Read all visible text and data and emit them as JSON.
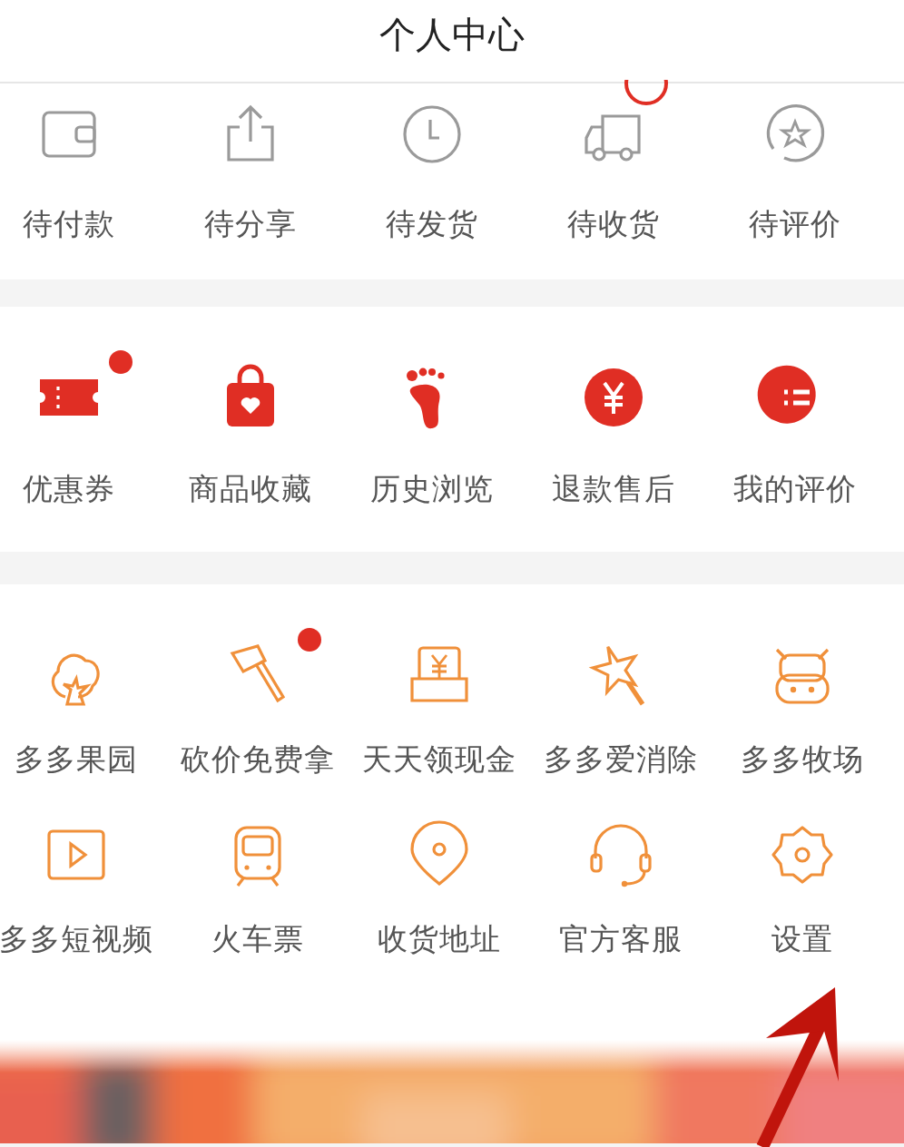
{
  "header": {
    "title": "个人中心"
  },
  "order_status": [
    {
      "label": "待付款",
      "badge": false
    },
    {
      "label": "待分享",
      "badge": false
    },
    {
      "label": "待发货",
      "badge": false
    },
    {
      "label": "待收货",
      "badge": true
    },
    {
      "label": "待评价",
      "badge": false
    }
  ],
  "services": [
    {
      "label": "优惠券",
      "dot": true
    },
    {
      "label": "商品收藏",
      "dot": false
    },
    {
      "label": "历史浏览",
      "dot": false
    },
    {
      "label": "退款售后",
      "dot": false
    },
    {
      "label": "我的评价",
      "dot": false
    }
  ],
  "tools": [
    {
      "label": "多多果园",
      "dot": false,
      "highlighted": false
    },
    {
      "label": "砍价免费拿",
      "dot": true,
      "highlighted": false
    },
    {
      "label": "天天领现金",
      "dot": false,
      "highlighted": false
    },
    {
      "label": "多多爱消除",
      "dot": false,
      "highlighted": false
    },
    {
      "label": "多多牧场",
      "dot": false,
      "highlighted": false
    },
    {
      "label": "多多短视频",
      "dot": false,
      "highlighted": false
    },
    {
      "label": "火车票",
      "dot": false,
      "highlighted": false
    },
    {
      "label": "收货地址",
      "dot": false,
      "highlighted": false
    },
    {
      "label": "官方客服",
      "dot": false,
      "highlighted": false
    },
    {
      "label": "设置",
      "dot": false,
      "highlighted": true
    }
  ]
}
